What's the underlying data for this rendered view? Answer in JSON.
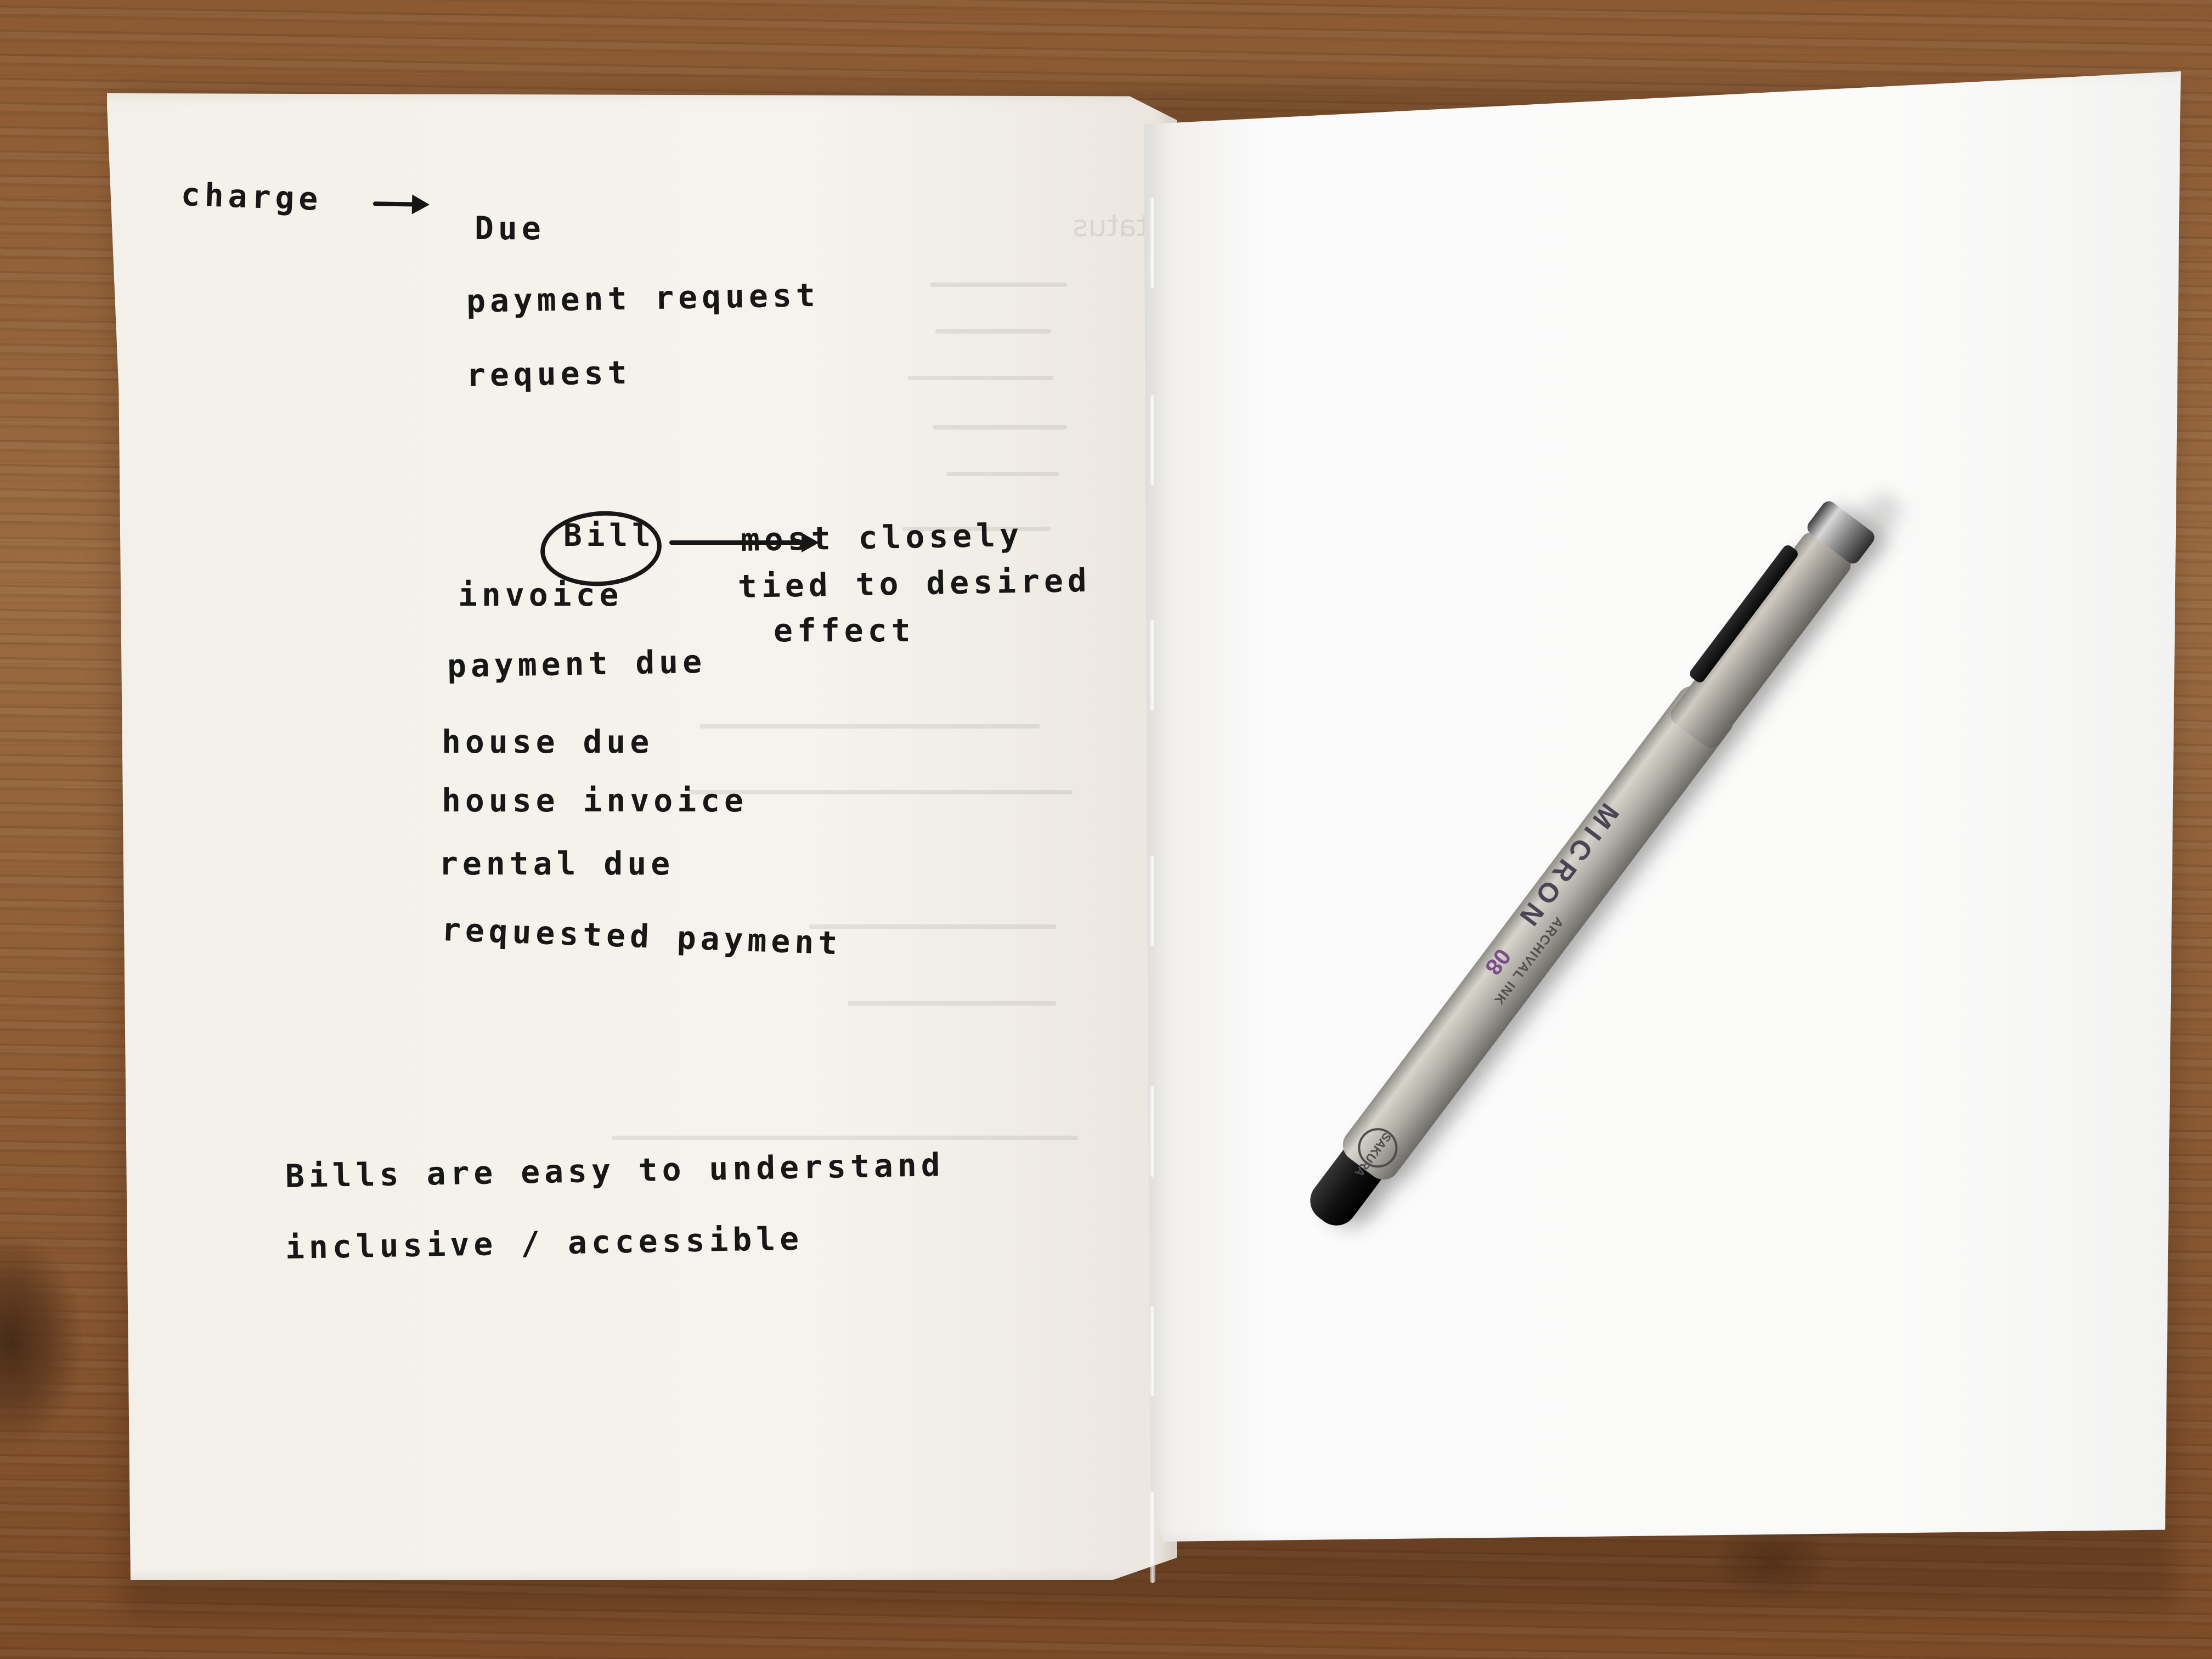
{
  "notes": {
    "left_column": [
      "charge",
      "Due",
      "payment request",
      "request",
      "Bill",
      "invoice",
      "payment due",
      "house due",
      "house invoice",
      "rental due",
      "requested payment"
    ],
    "bill_comment": [
      "most closely",
      "tied to desired",
      "effect"
    ],
    "footer": [
      "Bills are easy to understand",
      "inclusive / accessible"
    ]
  },
  "pen": {
    "brand": "MICRON",
    "size": "08",
    "small_text": "ARCHIVAL INK",
    "logo": "SAKURA"
  }
}
